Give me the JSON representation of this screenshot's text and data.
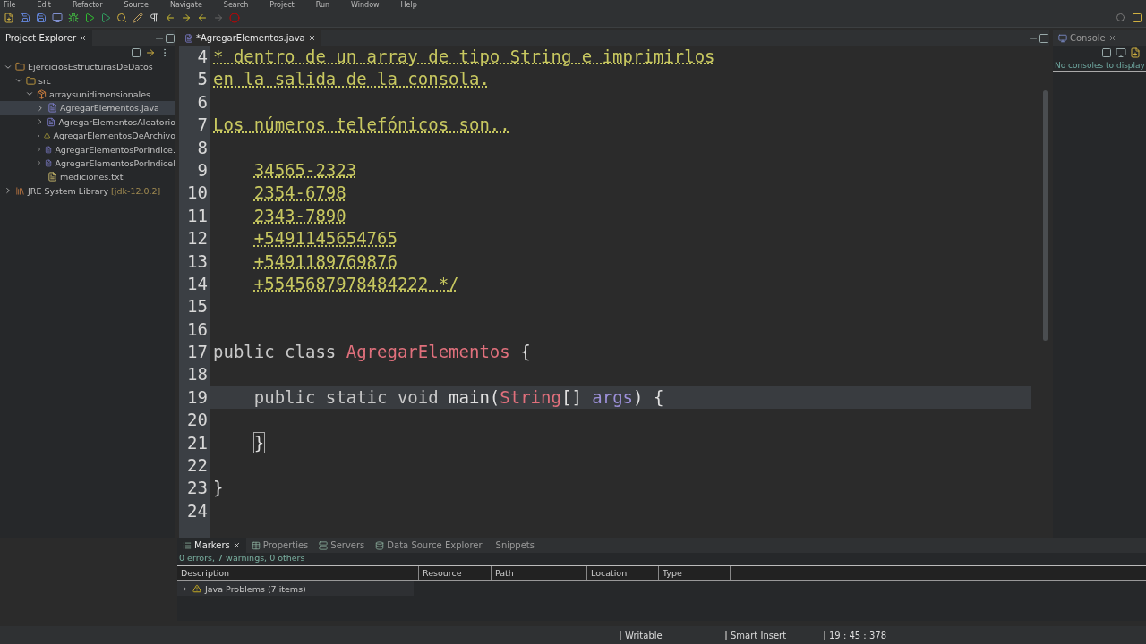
{
  "menu": [
    "File",
    "Edit",
    "Refactor",
    "Source",
    "Navigate",
    "Search",
    "Project",
    "Run",
    "Window",
    "Help"
  ],
  "explorer": {
    "title": "Project Explorer",
    "tree": [
      {
        "label": "EjerciciosEstructurasDeDatos",
        "kind": "project",
        "expanded": true,
        "selected": false,
        "children": [
          {
            "label": "src",
            "kind": "folder",
            "expanded": true,
            "selected": false,
            "children": [
              {
                "label": "arraysunidimensionales",
                "kind": "package",
                "expanded": true,
                "selected": false,
                "children": [
                  {
                    "label": "AgregarElementos.java",
                    "kind": "java",
                    "expanded": false,
                    "selected": true
                  },
                  {
                    "label": "AgregarElementosAleatorio",
                    "kind": "java",
                    "expanded": false,
                    "selected": false
                  },
                  {
                    "label": "AgregarElementosDeArchivo",
                    "kind": "java-warning",
                    "expanded": false,
                    "selected": false
                  },
                  {
                    "label": "AgregarElementosPorIndice.",
                    "kind": "java",
                    "expanded": false,
                    "selected": false
                  },
                  {
                    "label": "AgregarElementosPorIndiceI",
                    "kind": "java",
                    "expanded": false,
                    "selected": false
                  },
                  {
                    "label": "mediciones.txt",
                    "kind": "text",
                    "selected": false
                  }
                ]
              }
            ]
          }
        ]
      },
      {
        "label": "JRE System Library",
        "decoration": "[jdk-12.0.2]",
        "kind": "library",
        "expanded": false,
        "selected": false
      }
    ]
  },
  "editor": {
    "tabs": [
      {
        "label": "*AgregarElementos.java",
        "selected": true
      }
    ],
    "lines": [
      {
        "number": "4",
        "current": false,
        "tokens": [
          {
            "kind": "comment",
            "text": "* dentro de un array de tipo String e imprimirlos"
          }
        ]
      },
      {
        "number": "5",
        "current": false,
        "tokens": [
          {
            "kind": "comment",
            "text": "en la salida de la consola."
          }
        ]
      },
      {
        "number": "6"
      },
      {
        "number": "7",
        "current": false,
        "tokens": [
          {
            "kind": "comment",
            "text": "Los números telefónicos son.."
          }
        ]
      },
      {
        "number": "8"
      },
      {
        "number": "9",
        "current": false,
        "indented": true,
        "tokens": [
          {
            "kind": "comment",
            "text": "34565-2323"
          }
        ]
      },
      {
        "number": "10",
        "current": false,
        "indented": true,
        "tokens": [
          {
            "kind": "comment",
            "text": "2354-6798"
          }
        ]
      },
      {
        "number": "11",
        "current": false,
        "indented": true,
        "tokens": [
          {
            "kind": "comment",
            "text": "2343-7890"
          }
        ]
      },
      {
        "number": "12",
        "current": false,
        "indented": true,
        "tokens": [
          {
            "kind": "comment",
            "text": "+5491145654765"
          }
        ]
      },
      {
        "number": "13",
        "current": false,
        "indented": true,
        "tokens": [
          {
            "kind": "comment",
            "text": "+5491189769876"
          }
        ]
      },
      {
        "number": "14",
        "current": false,
        "indented": true,
        "tokens": [
          {
            "kind": "comment",
            "text": "+5545687978484222 */"
          }
        ]
      },
      {
        "number": "15"
      },
      {
        "number": "16"
      },
      {
        "number": "17",
        "current": false,
        "tokens": [
          {
            "kind": "keyword",
            "text": "public class "
          },
          {
            "kind": "type",
            "text": "AgregarElementos"
          },
          {
            "kind": "plain",
            "text": " {"
          }
        ]
      },
      {
        "number": "18"
      },
      {
        "number": "19",
        "current": true,
        "indented": true,
        "tokens": [
          {
            "kind": "keyword",
            "text": "public static void "
          },
          {
            "kind": "plain",
            "text": "main("
          },
          {
            "kind": "type",
            "text": "String"
          },
          {
            "kind": "plain",
            "text": "[] "
          },
          {
            "kind": "param",
            "text": "args"
          },
          {
            "kind": "plain",
            "text": ") {"
          }
        ]
      },
      {
        "number": "20"
      },
      {
        "number": "21",
        "current": false,
        "indented": true,
        "tokens": [
          {
            "kind": "bracket-match",
            "text": "}"
          }
        ]
      },
      {
        "number": "22"
      },
      {
        "number": "23",
        "current": false,
        "tokens": [
          {
            "kind": "plain",
            "text": "}"
          }
        ]
      },
      {
        "number": "24"
      }
    ]
  },
  "console": {
    "tab": {
      "label": "Console",
      "selected": false
    },
    "message": "No consoles to display"
  },
  "bottom": {
    "tabs": [
      {
        "label": "Markers",
        "selected": true
      },
      {
        "label": "Properties",
        "selected": false
      },
      {
        "label": "Servers",
        "selected": false
      },
      {
        "label": "Data Source Explorer",
        "selected": false
      },
      {
        "label": "Snippets",
        "selected": false
      }
    ],
    "summary": "0 errors, 7 warnings, 0 others",
    "columns": [
      "Description",
      "Resource",
      "Path",
      "Location",
      "Type"
    ],
    "rows": [
      {
        "label": "Java Problems (7 items)",
        "expanded": false
      }
    ]
  },
  "status_bar": [
    "Writable",
    "Smart Insert",
    "19 : 45 : 378"
  ]
}
